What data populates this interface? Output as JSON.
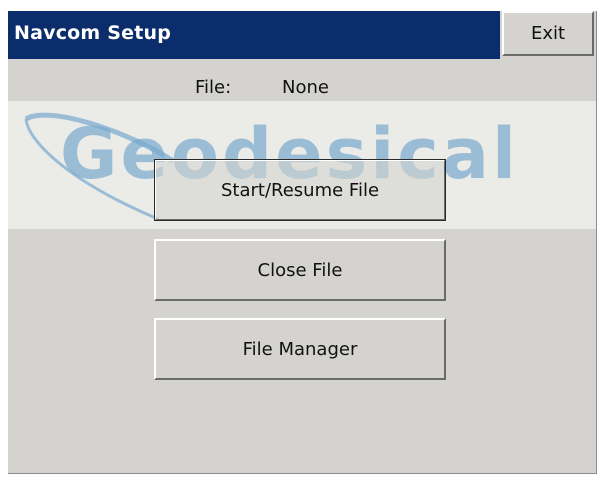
{
  "window": {
    "title": "Navcom Setup",
    "exit_label": "Exit"
  },
  "file": {
    "label": "File:",
    "value": "None"
  },
  "watermark": {
    "text": "Geodesical"
  },
  "buttons": {
    "start_resume": "Start/Resume File",
    "close_file": "Close File",
    "file_manager": "File Manager"
  },
  "colors": {
    "titlebar": "#0b2d6b",
    "window_bg": "#d4d3d0",
    "watermark": "#78aacd"
  }
}
